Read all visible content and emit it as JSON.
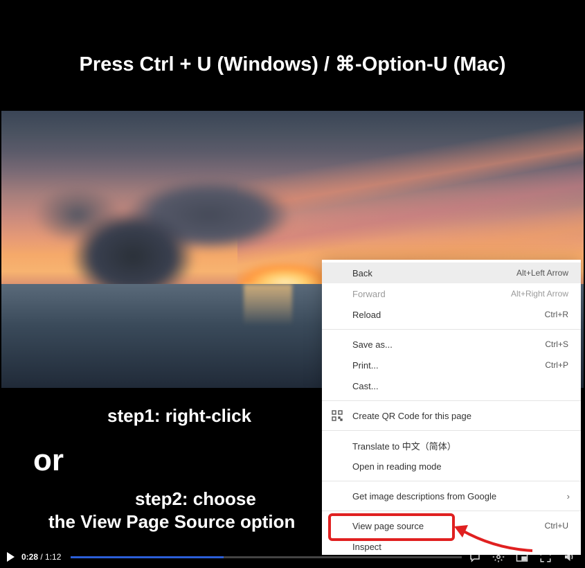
{
  "instruction": {
    "main": "Press Ctrl + U (Windows) / ⌘-Option-U (Mac)",
    "or": "or",
    "step1": "step1: right-click",
    "step2a": "step2: choose",
    "step2b": "the View Page Source option"
  },
  "context_menu": {
    "items": [
      {
        "label": "Back",
        "shortcut": "Alt+Left Arrow",
        "disabled": false,
        "hovered": true
      },
      {
        "label": "Forward",
        "shortcut": "Alt+Right Arrow",
        "disabled": true
      },
      {
        "label": "Reload",
        "shortcut": "Ctrl+R",
        "disabled": false
      }
    ],
    "items2": [
      {
        "label": "Save as...",
        "shortcut": "Ctrl+S"
      },
      {
        "label": "Print...",
        "shortcut": "Ctrl+P"
      },
      {
        "label": "Cast..."
      }
    ],
    "qr_item": {
      "label": "Create QR Code for this page"
    },
    "items3": [
      {
        "label": "Translate to 中文（简体）"
      },
      {
        "label": "Open in reading mode"
      }
    ],
    "items4": [
      {
        "label": "Get image descriptions from Google",
        "has_submenu": true
      }
    ],
    "items5": [
      {
        "label": "View page source",
        "shortcut": "Ctrl+U"
      },
      {
        "label": "Inspect"
      }
    ]
  },
  "player": {
    "current_time": "0:28",
    "separator": " / ",
    "duration": "1:12",
    "progress_percent": 39
  }
}
